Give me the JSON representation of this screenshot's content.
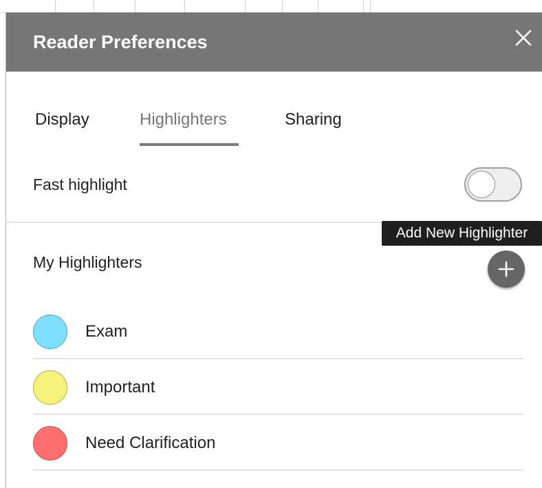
{
  "dialog": {
    "title": "Reader Preferences",
    "close_icon": "close-icon",
    "header_color": "#767676"
  },
  "tabs": [
    {
      "label": "Display",
      "active": false
    },
    {
      "label": "Highlighters",
      "active": true
    },
    {
      "label": "Sharing",
      "active": false
    }
  ],
  "fast_highlight": {
    "label": "Fast highlight",
    "enabled": false
  },
  "tooltip": {
    "text": "Add New Highlighter"
  },
  "my_highlighters": {
    "label": "My Highlighters",
    "add_icon": "plus-icon",
    "items": [
      {
        "label": "Exam",
        "color": "#80deff",
        "border": "#3aa8cc"
      },
      {
        "label": "Important",
        "color": "#f5f17a",
        "border": "#b3ad3a"
      },
      {
        "label": "Need Clarification",
        "color": "#ff6f6f",
        "border": "#c94b4b"
      }
    ]
  }
}
